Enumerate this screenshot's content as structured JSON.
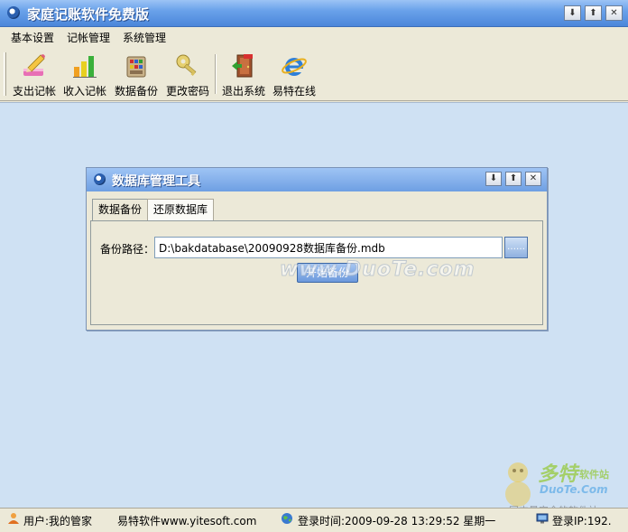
{
  "app": {
    "title": "家庭记账软件免费版",
    "window_buttons": {
      "minimize": "⬇",
      "restore": "⬆",
      "close": "✕"
    }
  },
  "menu": [
    "基本设置",
    "记帐管理",
    "系统管理"
  ],
  "toolbar": [
    {
      "label": "支出记帐",
      "icon": "pencil-eraser-icon"
    },
    {
      "label": "收入记帐",
      "icon": "bar-chart-icon"
    },
    {
      "label": "数据备份",
      "icon": "database-backup-icon"
    },
    {
      "label": "更改密码",
      "icon": "key-icon"
    },
    {
      "label": "退出系统",
      "icon": "exit-door-icon"
    },
    {
      "label": "易特在线",
      "icon": "internet-explorer-icon"
    }
  ],
  "dialog": {
    "title": "数据库管理工具",
    "tabs": [
      {
        "label": "数据备份",
        "active": true
      },
      {
        "label": "还原数据库",
        "active": false
      }
    ],
    "path_label": "备份路径：",
    "path_value": "D:\\bakdatabase\\20090928数据库备份.mdb",
    "browse_label": "……",
    "start_button": "开始备份"
  },
  "watermark": {
    "text": "www.DuoTe.com",
    "logo_main": "多特",
    "logo_sub": "软件站",
    "logo_domain": "DuoTe.Com",
    "logo_slogan": "国内最安全的软件站"
  },
  "status": {
    "user": "用户:我的管家",
    "company": "易特软件www.yitesoft.com",
    "login_time": "登录时间:2009-09-28 13:29:52 星期一",
    "login_ip": "登录IP:192."
  },
  "colors": {
    "title_bar": "#6aa2ea",
    "workspace": "#cfe1f3",
    "window_bg": "#ece9d8",
    "button_blue": "#6c99dc"
  }
}
